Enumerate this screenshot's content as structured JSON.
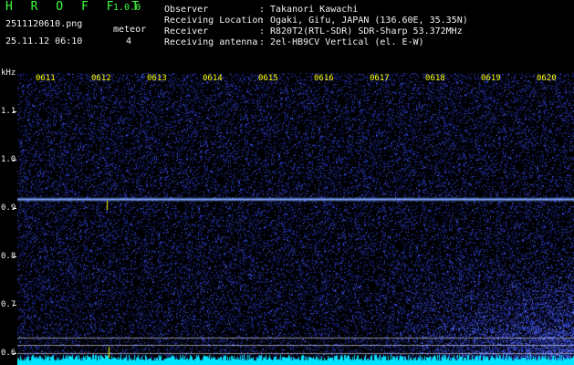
{
  "header": {
    "brand": "H R O F F T",
    "version": "1.0.0",
    "filename": "2511120610.png",
    "timestamp": "25.11.12 06:10",
    "meteor_label": "meteor",
    "meteor_count": "4"
  },
  "info": [
    {
      "label": "Observer",
      "value": "Takanori Kawachi"
    },
    {
      "label": "Receiving Location",
      "value": "Ogaki, Gifu, JAPAN (136.60E, 35.35N)"
    },
    {
      "label": "Receiver",
      "value": "R820T2(RTL-SDR) SDR-Sharp 53.372MHz"
    },
    {
      "label": "Receiving antenna",
      "value": "2el-HB9CV Vertical (el. E-W)"
    }
  ],
  "separator": ":",
  "chart_data": {
    "type": "heatmap",
    "ylabel": "kHz",
    "y_ticks": [
      "1.1",
      "1.0",
      "0.9",
      "0.8",
      "0.7",
      "0.6"
    ],
    "x_ticks": [
      "0611",
      "0612",
      "0613",
      "0614",
      "0615",
      "0616",
      "0617",
      "0618",
      "0619",
      "0620"
    ],
    "ylim": [
      0.575,
      1.18
    ],
    "carrier_khz": 0.92,
    "colors": {
      "background": "#000000",
      "noise": "#1a2aa8",
      "carrier": "#7fa6ff",
      "baseline": "#00e5ff",
      "marker": "#ffff00"
    }
  }
}
